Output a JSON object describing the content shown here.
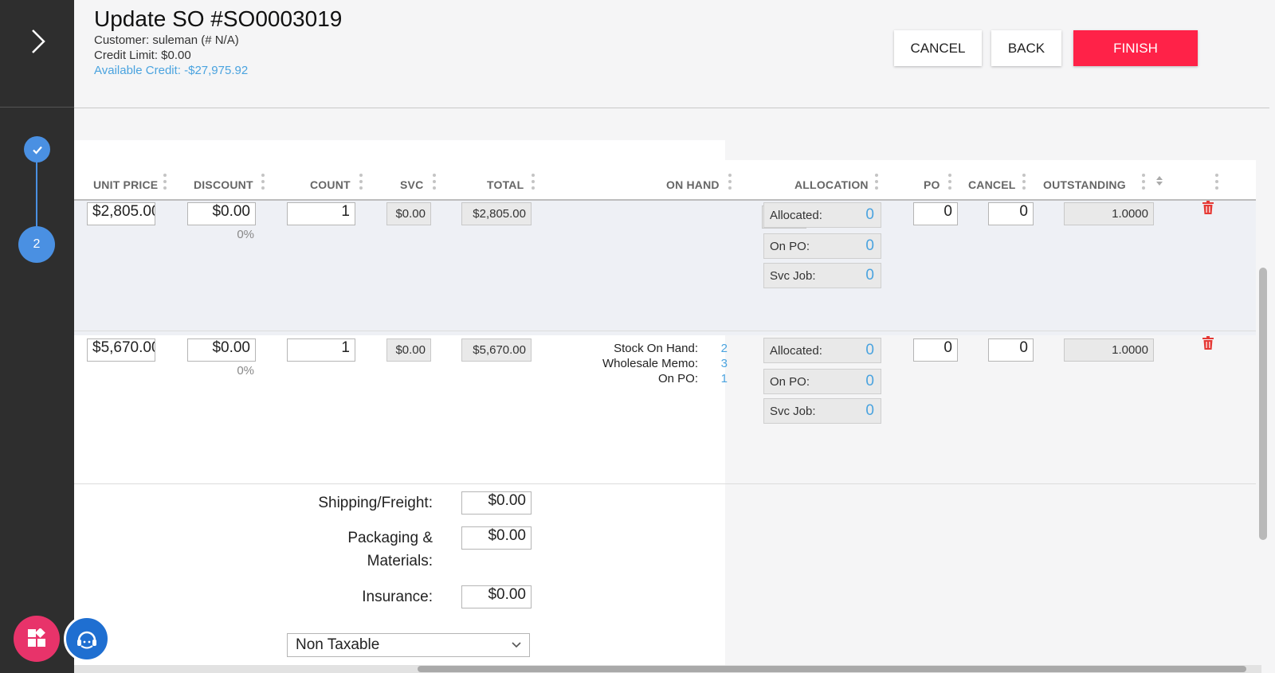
{
  "sidebar": {
    "expand_icon": "chevron-right-icon",
    "steps": [
      {
        "state": "done",
        "icon": "check-icon"
      },
      {
        "state": "current",
        "label": "2"
      }
    ],
    "fab_apps_icon": "apps-grid-icon",
    "fab_support_icon": "support-agent-icon"
  },
  "header": {
    "title": "Update SO #SO0003019",
    "customer": "Customer: suleman (# N/A)",
    "credit_limit": "Credit Limit: $0.00",
    "available_credit": "Available Credit: -$27,975.92",
    "buttons": {
      "cancel": "CANCEL",
      "back": "BACK",
      "finish": "FINISH"
    }
  },
  "table": {
    "columns": {
      "unit_price": "UNIT PRICE",
      "discount": "DISCOUNT",
      "count": "COUNT",
      "svc": "SVC",
      "total": "TOTAL",
      "on_hand": "ON HAND",
      "allocation": "ALLOCATION",
      "po": "PO",
      "cancel": "CANCEL",
      "outstanding": "OUTSTANDING"
    },
    "rows": [
      {
        "unit_price": "$2,805.00",
        "discount": "$0.00",
        "discount_pct": "0%",
        "count": "1",
        "svc": "$0.00",
        "total": "$2,805.00",
        "on_hand_icon": "infinity-icon",
        "allocated_label": "Allocated:",
        "allocated": "0",
        "on_po_label": "On PO:",
        "on_po": "0",
        "svc_job_label": "Svc Job:",
        "svc_job": "0",
        "po": "0",
        "cancel": "0",
        "outstanding": "1.0000"
      },
      {
        "unit_price": "$5,670.00",
        "discount": "$0.00",
        "discount_pct": "0%",
        "count": "1",
        "svc": "$0.00",
        "total": "$5,670.00",
        "stock_on_hand_label": "Stock On Hand:",
        "stock_on_hand": "2",
        "wholesale_memo_label": "Wholesale Memo:",
        "wholesale_memo": "3",
        "stock_on_po_label": "On PO:",
        "stock_on_po": "1",
        "allocated_label": "Allocated:",
        "allocated": "0",
        "on_po_label": "On PO:",
        "on_po": "0",
        "svc_job_label": "Svc Job:",
        "svc_job": "0",
        "po": "0",
        "cancel": "0",
        "outstanding": "1.0000"
      }
    ]
  },
  "footer": {
    "shipping_label": "Shipping/Freight:",
    "shipping": "$0.00",
    "packaging_label_1": "Packaging &",
    "packaging_label_2": "Materials:",
    "packaging": "$0.00",
    "insurance_label": "Insurance:",
    "insurance": "$0.00",
    "tax_select": "Non Taxable"
  }
}
